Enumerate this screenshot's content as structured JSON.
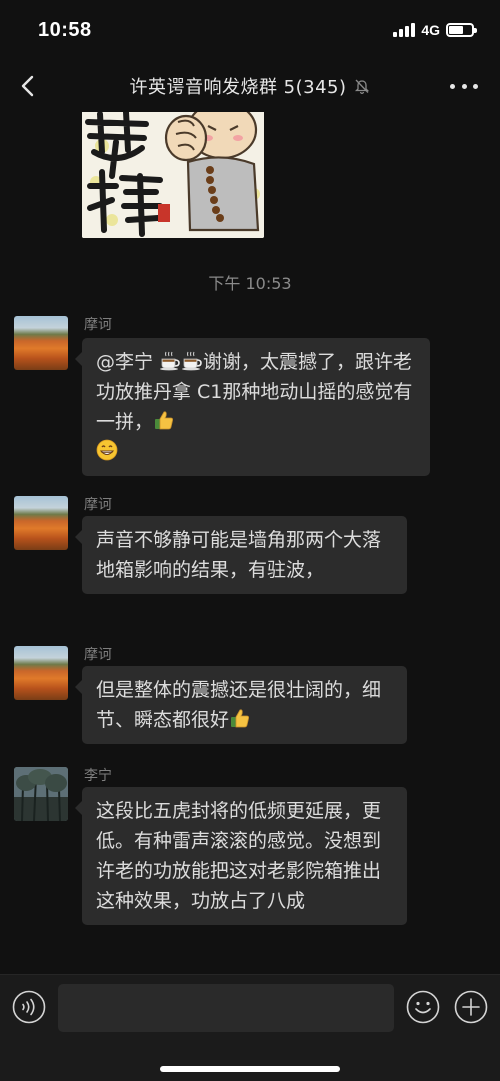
{
  "status": {
    "time": "10:58",
    "network": "4G",
    "battery_level": 0.65
  },
  "header": {
    "back_icon": "chevron-left-icon",
    "title": "许英谔音响发烧群 5(345)",
    "mute_icon": "bell-slash-icon",
    "more_icon": "more-horizontal-icon"
  },
  "chat": {
    "time_divider": "下午 10:53",
    "messages": [
      {
        "sender": "摩诃",
        "avatar": "orange-flower-field",
        "segments": [
          "@李宁 ",
          "coffee-emoji",
          "coffee-emoji",
          "谢谢，太震撼了，跟许老功放推丹拿 C1那种地动山摇的感觉有一拼，",
          "thumbs-up-emoji",
          "grin-emoji"
        ]
      },
      {
        "sender": "摩诃",
        "avatar": "orange-flower-field",
        "text": "声音不够静可能是墙角那两个大落地箱影响的结果，有驻波，"
      },
      {
        "sender": "摩诃",
        "avatar": "orange-flower-field",
        "segments": [
          "但是整体的震撼还是很壮阔的，细节、瞬态都很好",
          "thumbs-up-emoji"
        ]
      },
      {
        "sender": "李宁",
        "avatar": "tree-landscape",
        "text": "这段比五虎封将的低频更延展，更低。有种雷声滚滚的感觉。没想到许老的功放能把这对老影院箱推出这种效果，功放占了八成"
      }
    ]
  },
  "input_bar": {
    "voice_icon": "voice-wave-icon",
    "input_value": "",
    "emoji_icon": "smiley-icon",
    "plus_icon": "plus-circle-icon"
  },
  "colors": {
    "background": "#111111",
    "bubble": "#2c2c2c",
    "text": "#dcdcdc",
    "muted_text": "#7f7f7f"
  }
}
